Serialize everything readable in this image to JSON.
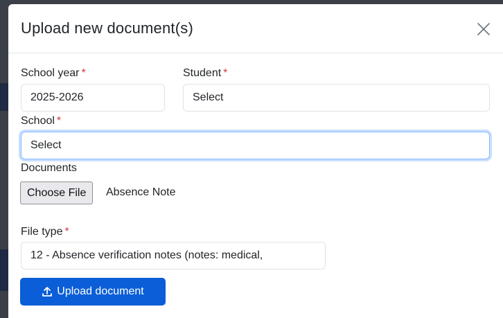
{
  "modal": {
    "title": "Upload new document(s)"
  },
  "form": {
    "school_year": {
      "label": "School year",
      "required_mark": "*",
      "value": "2025-2026"
    },
    "student": {
      "label": "Student",
      "required_mark": "*",
      "value": "Select"
    },
    "school": {
      "label": "School",
      "required_mark": "*",
      "value": "Select"
    },
    "documents": {
      "label": "Documents",
      "button_label": "Choose File",
      "file_name": "Absence Note"
    },
    "file_type": {
      "label": "File type",
      "required_mark": "*",
      "value": "12 - Absence verification notes (notes: medical,"
    }
  },
  "actions": {
    "upload_label": "Upload document"
  },
  "colors": {
    "primary": "#0b5ed7",
    "required": "#d63348",
    "focus_border": "#86b7fe"
  },
  "icons": {
    "close": "close-icon",
    "upload": "upload-icon"
  }
}
